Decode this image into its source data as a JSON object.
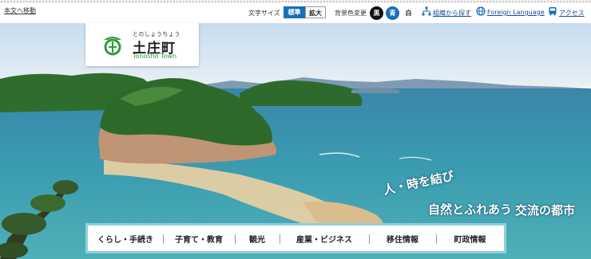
{
  "header": {
    "skip_link": "本文へ移動",
    "font_size": {
      "label": "文字サイズ",
      "standard": "標準",
      "large": "拡大"
    },
    "background": {
      "label": "背景色変更",
      "black": "黒",
      "blue": "青",
      "white": "白"
    },
    "links": {
      "org": "組織から探す",
      "foreign": "Foreign Language",
      "access": "アクセス"
    }
  },
  "logo": {
    "ruby": "とのしょうちょう",
    "name_ja": "土庄町",
    "name_en": "Tonosho Town"
  },
  "tagline": {
    "line1": "人・時を結び",
    "line2": "自然とふれあう",
    "line3": "交流の都市"
  },
  "nav": {
    "items": [
      {
        "label": "くらし・手続き"
      },
      {
        "label": "子育て・教育"
      },
      {
        "label": "観光"
      },
      {
        "label": "産業・ビジネス"
      },
      {
        "label": "移住情報"
      },
      {
        "label": "町政情報"
      }
    ]
  },
  "colors": {
    "accent_blue": "#1a6fb5",
    "logo_green": "#2f9c3b",
    "nav_border": "#8fd0df"
  },
  "icons": {
    "org": "org-chart-icon",
    "foreign": "globe-icon",
    "access": "bus-icon",
    "emblem": "town-emblem"
  }
}
